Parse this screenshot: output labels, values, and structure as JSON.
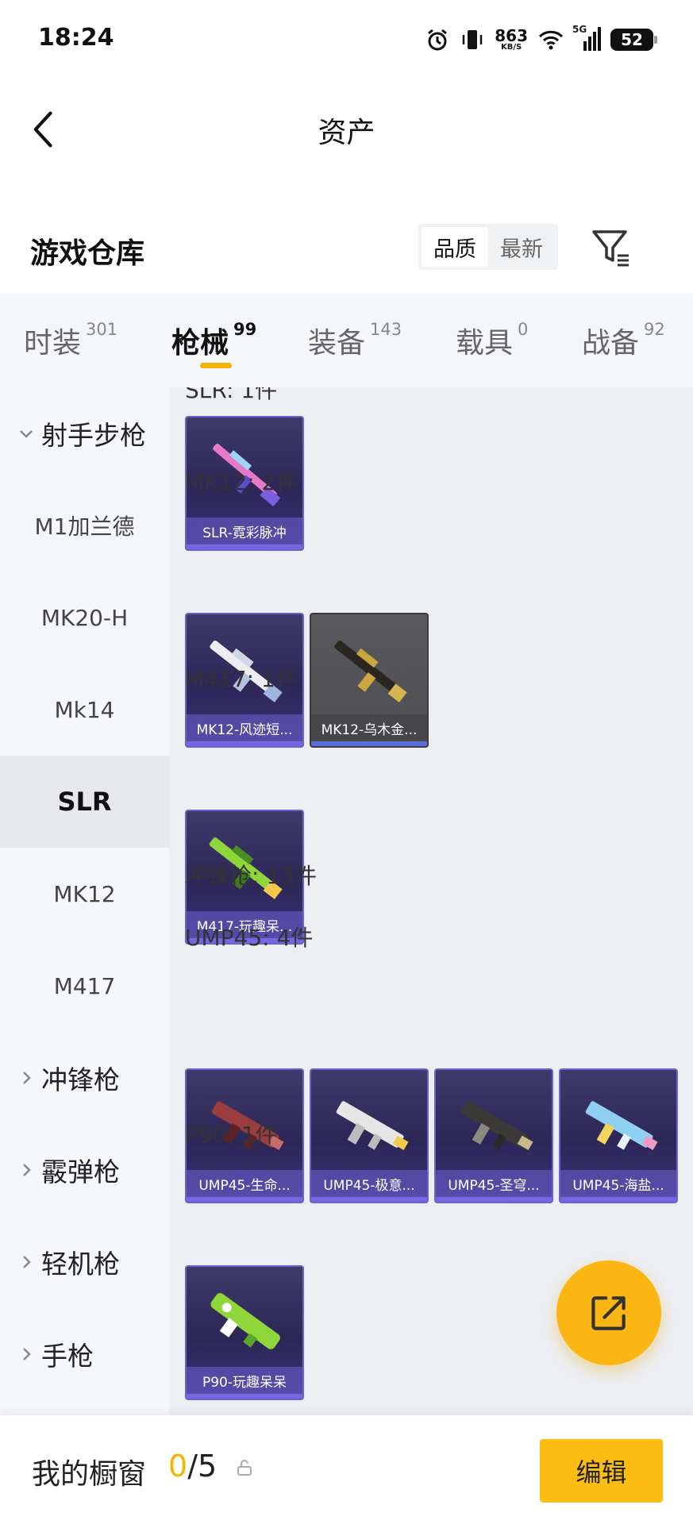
{
  "status_bar": {
    "time": "18:24",
    "network_speed": "863",
    "network_unit": "KB/S",
    "network_type": "5G",
    "battery": "52",
    "icons": [
      "alarm-icon",
      "vibrate-icon",
      "wifi-icon",
      "signal-icon",
      "battery-icon"
    ]
  },
  "nav": {
    "title": "资产",
    "back_icon": "back-arrow-icon"
  },
  "warehouse": {
    "title": "游戏仓库",
    "sort_options": [
      "品质",
      "最新"
    ],
    "sort_selected": "品质",
    "filter_icon": "filter-icon"
  },
  "tabs": [
    {
      "label": "时装",
      "count": "301"
    },
    {
      "label": "枪械",
      "count": "99"
    },
    {
      "label": "装备",
      "count": "143"
    },
    {
      "label": "载具",
      "count": "0"
    },
    {
      "label": "战备",
      "count": "92"
    }
  ],
  "active_tab": "枪械",
  "sidebar": {
    "items": [
      {
        "label": "射手步枪",
        "type": "group",
        "expanded": true
      },
      {
        "label": "M1加兰德",
        "type": "item"
      },
      {
        "label": "MK20-H",
        "type": "item"
      },
      {
        "label": "Mk14",
        "type": "item"
      },
      {
        "label": "SLR",
        "type": "item",
        "active": true
      },
      {
        "label": "MK12",
        "type": "item"
      },
      {
        "label": "M417",
        "type": "item"
      },
      {
        "label": "冲锋枪",
        "type": "group",
        "expanded": false
      },
      {
        "label": "霰弹枪",
        "type": "group",
        "expanded": false
      },
      {
        "label": "轻机枪",
        "type": "group",
        "expanded": false
      },
      {
        "label": "手枪",
        "type": "group",
        "expanded": false
      }
    ]
  },
  "content": {
    "groups": [
      {
        "label": "SLR: 1件",
        "items": [
          {
            "name": "SLR-霓彩脉冲",
            "color": "#e879c4"
          }
        ]
      },
      {
        "label": "MK12: 2件",
        "items": [
          {
            "name": "MK12-风迹短...",
            "color": "#e8e8ee"
          },
          {
            "name": "MK12-乌木金...",
            "color": "#c9a640",
            "gray": true
          }
        ]
      },
      {
        "label": "M417: 1件",
        "items": [
          {
            "name": "M417-玩趣呆...",
            "color": "#8fd63a"
          }
        ]
      },
      {
        "label": "冲锋枪: 13件",
        "items": []
      },
      {
        "label": "UMP45: 4件",
        "items": [
          {
            "name": "UMP45-生命...",
            "color": "#9b3d3d"
          },
          {
            "name": "UMP45-极意...",
            "color": "#e6e6e6"
          },
          {
            "name": "UMP45-圣穹...",
            "color": "#8a8a80"
          },
          {
            "name": "UMP45-海盐...",
            "color": "#8fd0f0"
          }
        ]
      },
      {
        "label": "P90: 1件",
        "items": [
          {
            "name": "P90-玩趣呆呆",
            "color": "#8fd63a"
          }
        ]
      }
    ]
  },
  "fab": {
    "icon": "share-export-icon",
    "color": "#fbb614"
  },
  "bottom_bar": {
    "title": "我的橱窗",
    "count_current": "0",
    "count_total": "/5",
    "lock_icon": "lock-icon",
    "edit_label": "编辑"
  },
  "colors": {
    "accent": "#f5b400",
    "card_border": "#6d62c9",
    "card_bg": "#2d2758"
  }
}
